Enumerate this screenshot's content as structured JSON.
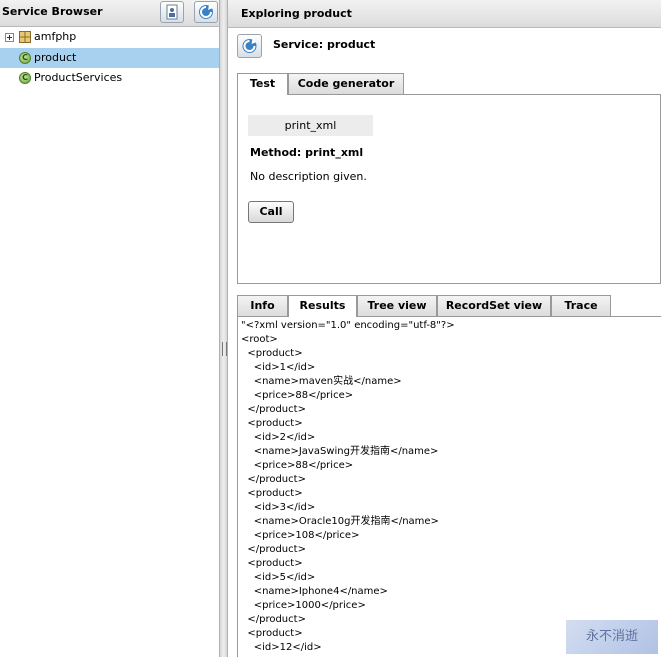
{
  "left_panel": {
    "title": "Service Browser",
    "tree": [
      {
        "label": "amfphp",
        "type": "package",
        "expandable": true,
        "selected": false
      },
      {
        "label": "product",
        "type": "service",
        "expandable": false,
        "selected": true
      },
      {
        "label": "ProductServices",
        "type": "service",
        "expandable": false,
        "selected": false
      }
    ],
    "icons": {
      "user_button": "user-info-icon",
      "refresh_button": "refresh-icon"
    }
  },
  "right_panel": {
    "title": "Exploring product",
    "service_title": "Service: product",
    "upper_tabs": [
      {
        "label": "Test",
        "active": true
      },
      {
        "label": "Code generator",
        "active": false
      }
    ],
    "method_item": "print_xml",
    "method_label": "Method: print_xml",
    "description": "No description given.",
    "call_button": "Call",
    "lower_tabs": [
      {
        "label": "Info",
        "active": false
      },
      {
        "label": "Results",
        "active": true
      },
      {
        "label": "Tree view",
        "active": false
      },
      {
        "label": "RecordSet view",
        "active": false
      },
      {
        "label": "Trace",
        "active": false
      }
    ],
    "results_lines": [
      "\"<?xml version=\"1.0\" encoding=\"utf-8\"?>",
      "<root>",
      "  <product>",
      "    <id>1</id>",
      "    <name>maven实战</name>",
      "    <price>88</price>",
      "  </product>",
      "  <product>",
      "    <id>2</id>",
      "    <name>JavaSwing开发指南</name>",
      "    <price>88</price>",
      "  </product>",
      "  <product>",
      "    <id>3</id>",
      "    <name>Oracle10g开发指南</name>",
      "    <price>108</price>",
      "  </product>",
      "  <product>",
      "    <id>5</id>",
      "    <name>Iphone4</name>",
      "    <price>1000</price>",
      "  </product>",
      "  <product>",
      "    <id>12</id>"
    ]
  },
  "colors": {
    "selection": "#a8d0ef",
    "header_bg": "#e4e4e4",
    "border": "#999999"
  },
  "watermark": "永不消逝"
}
